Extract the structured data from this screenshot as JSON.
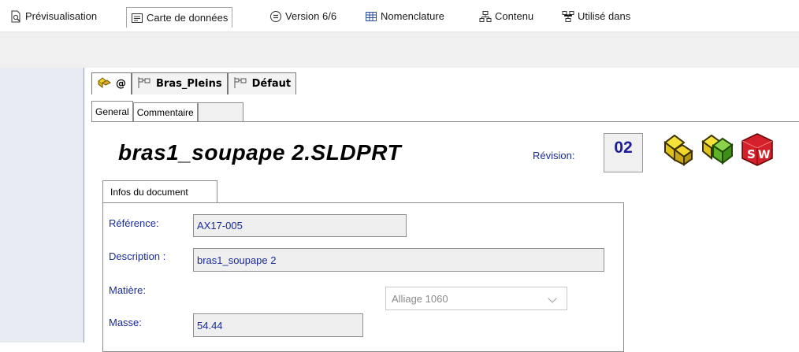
{
  "toolbar": {
    "tabs": [
      {
        "label": "Prévisualisation",
        "icon": "preview-icon"
      },
      {
        "label": "Carte de données",
        "icon": "data-card-icon"
      },
      {
        "label": "Version 6/6",
        "icon": "version-icon"
      },
      {
        "label": "Nomenclature",
        "icon": "bom-icon"
      },
      {
        "label": "Contenu",
        "icon": "contents-icon"
      },
      {
        "label": "Utilisé dans",
        "icon": "where-used-icon"
      }
    ]
  },
  "config_tabs": [
    {
      "label": "@",
      "icon": "part-config-icon"
    },
    {
      "label": "Bras_Pleins",
      "icon": "configuration-icon"
    },
    {
      "label": "Défaut",
      "icon": "configuration-icon"
    }
  ],
  "inner_tabs": [
    {
      "label": "General"
    },
    {
      "label": "Commentaire"
    }
  ],
  "document": {
    "title": "bras1_soupape 2.SLDPRT",
    "revision_label": "Révision:",
    "revision_value": "02",
    "icons": [
      "part-icon",
      "part-green-icon",
      "solidworks-icon"
    ]
  },
  "infos": {
    "tab_label": "Infos du document",
    "reference_label": "Référence:",
    "reference_value": "AX17-005",
    "description_label": "Description :",
    "description_value": "bras1_soupape 2",
    "material_label": "Matière:",
    "material_value": "Alliage 1060",
    "mass_label": "Masse:",
    "mass_value": "54.44"
  },
  "colors": {
    "label_blue": "#1a2a9a",
    "accent_yellow": "#f2d21e",
    "accent_green": "#4caf2e",
    "sw_red": "#d3202a"
  }
}
